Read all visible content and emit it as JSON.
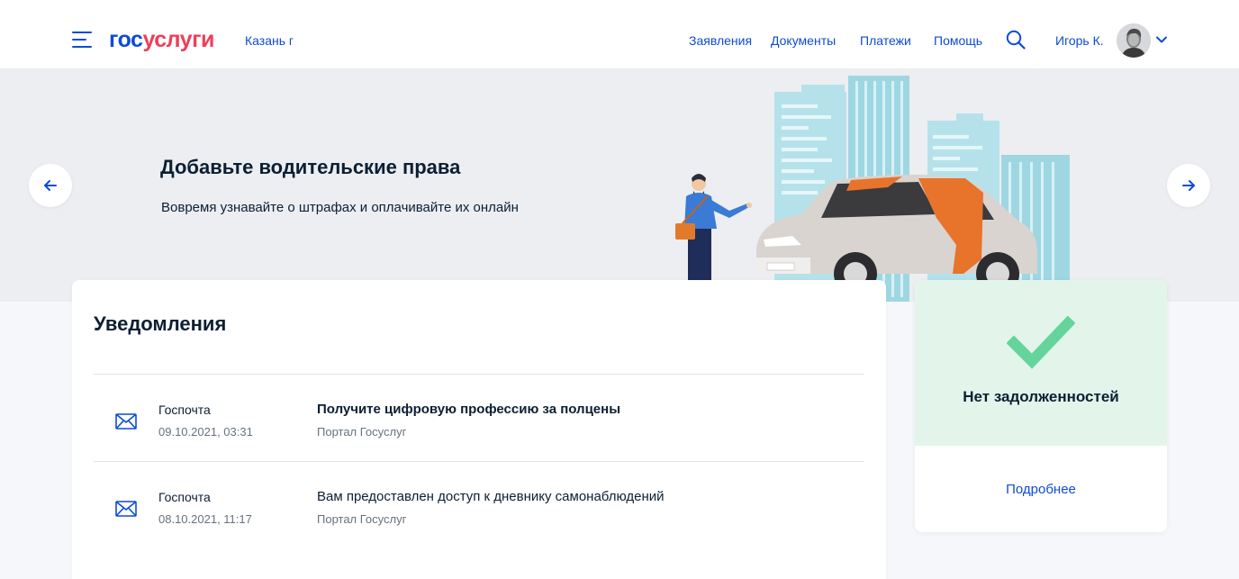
{
  "header": {
    "logo_part1": "гос",
    "logo_part2": "услуги",
    "city": "Казань г",
    "nav": [
      "Заявления",
      "Документы",
      "Платежи",
      "Помощь"
    ],
    "user_name": "Игорь К."
  },
  "banner": {
    "title": "Добавьте водительские права",
    "subtitle": "Вовремя узнавайте о штрафах и оплачивайте их онлайн"
  },
  "notifications": {
    "heading": "Уведомления",
    "items": [
      {
        "sender": "Госпочта",
        "date": "09.10.2021, 03:31",
        "subject": "Получите цифровую профессию за полцены",
        "source": "Портал Госуслуг",
        "unread": true
      },
      {
        "sender": "Госпочта",
        "date": "08.10.2021, 11:17",
        "subject": "Вам предоставлен доступ к дневнику самонаблюдений",
        "source": "Портал Госуслуг",
        "unread": false
      }
    ]
  },
  "debt": {
    "title": "Нет задолженностей",
    "link": "Подробнее"
  },
  "colors": {
    "brand_blue": "#0d4cd3",
    "brand_red": "#ee3f58",
    "success_green": "#64d49b",
    "success_bg": "#e3f5ea"
  },
  "icons": [
    "menu-icon",
    "search-icon",
    "chevron-down-icon",
    "arrow-left-icon",
    "arrow-right-icon",
    "mail-icon",
    "check-icon"
  ]
}
